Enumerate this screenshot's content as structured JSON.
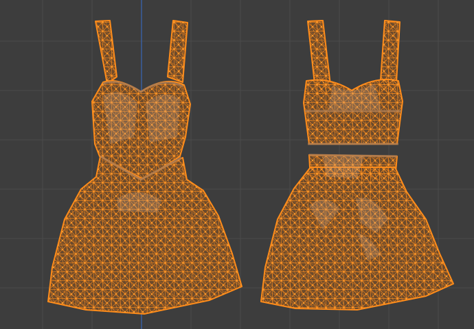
{
  "viewport": {
    "background_color": "#3d3d3d",
    "grid_color": "#4a4a4a",
    "axis_color": "#3a5f9e",
    "selection_color": "#ff8c1a",
    "mesh_fill_color": "#6b4a2c"
  },
  "meshes": [
    {
      "id": "dress-front",
      "view": "front",
      "selected": true
    },
    {
      "id": "dress-back",
      "view": "back",
      "selected": true
    }
  ]
}
